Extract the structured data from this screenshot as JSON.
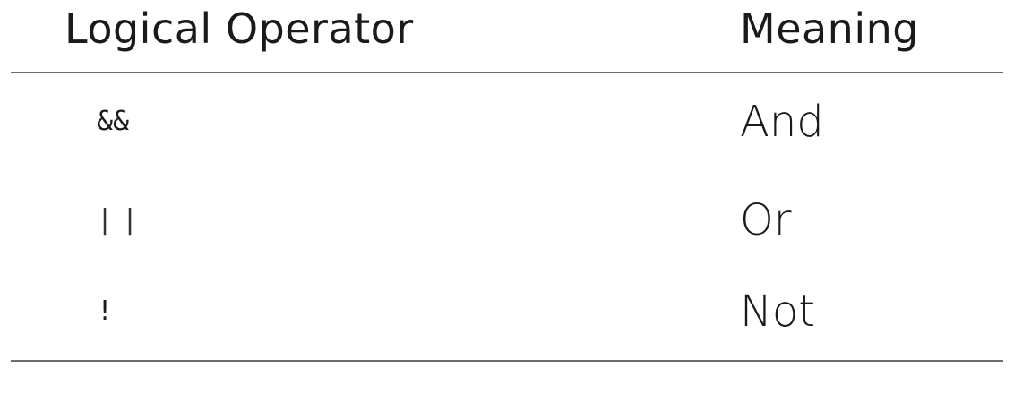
{
  "table": {
    "headers": {
      "operator": "Logical Operator",
      "meaning": "Meaning"
    },
    "rows": [
      {
        "operator": "&&",
        "meaning": "And"
      },
      {
        "operator": "||",
        "meaning": "Or"
      },
      {
        "operator": "!",
        "meaning": "Not"
      }
    ]
  },
  "colors": {
    "text": "#1a1a1a",
    "rule": "#6b6b70",
    "background": "#ffffff"
  }
}
